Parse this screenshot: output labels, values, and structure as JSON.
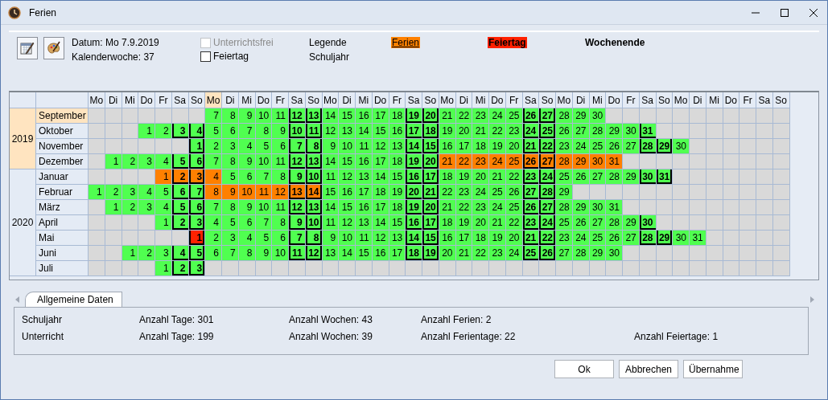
{
  "window": {
    "title": "Ferien"
  },
  "info": {
    "date": "Datum: Mo 7.9.2019",
    "week": "Kalenderwoche: 37"
  },
  "checkboxes": [
    {
      "label": "Unterrichtsfrei",
      "checked": false,
      "disabled": true
    },
    {
      "label": "Feiertag",
      "checked": false,
      "disabled": false
    }
  ],
  "legend": {
    "title": "Legende",
    "subtitle": "Schuljahr",
    "items": [
      {
        "label": "Ferien",
        "kind": "ferien",
        "color": "#ff8000"
      },
      {
        "label": "Feiertag",
        "kind": "feiertag",
        "color": "#ff2000"
      },
      {
        "label": "Wochenende",
        "kind": "weekend"
      }
    ]
  },
  "calendar": {
    "columns": [
      {
        "label": "Mo",
        "selected": false
      },
      {
        "label": "Di",
        "selected": false
      },
      {
        "label": "Mi",
        "selected": false
      },
      {
        "label": "Do",
        "selected": false
      },
      {
        "label": "Fr",
        "selected": false
      },
      {
        "label": "Sa",
        "selected": false
      },
      {
        "label": "So",
        "selected": false
      },
      {
        "label": "Mo",
        "selected": true
      },
      {
        "label": "Di",
        "selected": false
      },
      {
        "label": "Mi",
        "selected": false
      },
      {
        "label": "Do",
        "selected": false
      },
      {
        "label": "Fr",
        "selected": false
      },
      {
        "label": "Sa",
        "selected": false
      },
      {
        "label": "So",
        "selected": false
      },
      {
        "label": "Mo",
        "selected": false
      },
      {
        "label": "Di",
        "selected": false
      },
      {
        "label": "Mi",
        "selected": false
      },
      {
        "label": "Do",
        "selected": false
      },
      {
        "label": "Fr",
        "selected": false
      },
      {
        "label": "Sa",
        "selected": false
      },
      {
        "label": "So",
        "selected": false
      },
      {
        "label": "Mo",
        "selected": false
      },
      {
        "label": "Di",
        "selected": false
      },
      {
        "label": "Mi",
        "selected": false
      },
      {
        "label": "Do",
        "selected": false
      },
      {
        "label": "Fr",
        "selected": false
      },
      {
        "label": "Sa",
        "selected": false
      },
      {
        "label": "So",
        "selected": false
      },
      {
        "label": "Mo",
        "selected": false
      },
      {
        "label": "Di",
        "selected": false
      },
      {
        "label": "Mi",
        "selected": false
      },
      {
        "label": "Do",
        "selected": false
      },
      {
        "label": "Fr",
        "selected": false
      },
      {
        "label": "Sa",
        "selected": false
      },
      {
        "label": "So",
        "selected": false
      },
      {
        "label": "Mo",
        "selected": false
      },
      {
        "label": "Di",
        "selected": false
      },
      {
        "label": "Mi",
        "selected": false
      },
      {
        "label": "Do",
        "selected": false
      },
      {
        "label": "Fr",
        "selected": false
      },
      {
        "label": "Sa",
        "selected": false
      },
      {
        "label": "So",
        "selected": false
      }
    ],
    "years": [
      {
        "year": "2019",
        "selected": true,
        "months": [
          {
            "name": "September",
            "selected": true,
            "cells": [
              {
                "kind": "blank"
              },
              {
                "kind": "blank"
              },
              {
                "kind": "blank"
              },
              {
                "kind": "blank"
              },
              {
                "kind": "blank"
              },
              {
                "kind": "blank"
              },
              {
                "kind": "blank"
              },
              {
                "day": "7",
                "kind": "school"
              },
              {
                "day": "8",
                "kind": "school"
              },
              {
                "day": "9",
                "kind": "school"
              },
              {
                "day": "10",
                "kind": "school"
              },
              {
                "day": "11",
                "kind": "school"
              },
              {
                "day": "12",
                "kind": "school"
              },
              {
                "day": "13",
                "kind": "school"
              },
              {
                "day": "14",
                "kind": "school"
              },
              {
                "day": "15",
                "kind": "school"
              },
              {
                "day": "16",
                "kind": "school"
              },
              {
                "day": "17",
                "kind": "school"
              },
              {
                "day": "18",
                "kind": "school"
              },
              {
                "day": "19",
                "kind": "school"
              },
              {
                "day": "20",
                "kind": "school"
              },
              {
                "day": "21",
                "kind": "school"
              },
              {
                "day": "22",
                "kind": "school"
              },
              {
                "day": "23",
                "kind": "school"
              },
              {
                "day": "24",
                "kind": "school"
              },
              {
                "day": "25",
                "kind": "school"
              },
              {
                "day": "26",
                "kind": "school"
              },
              {
                "day": "27",
                "kind": "school"
              },
              {
                "day": "28",
                "kind": "school"
              },
              {
                "day": "29",
                "kind": "school"
              },
              {
                "day": "30",
                "kind": "school"
              }
            ]
          },
          {
            "name": "Oktober",
            "selected": false,
            "cells": [
              {
                "kind": "blank"
              },
              {
                "kind": "blank"
              },
              {
                "kind": "blank"
              },
              {
                "day": "1",
                "kind": "school"
              },
              {
                "day": "2",
                "kind": "school"
              },
              {
                "day": "3",
                "kind": "school"
              },
              {
                "day": "4",
                "kind": "school"
              },
              {
                "day": "5",
                "kind": "school"
              },
              {
                "day": "6",
                "kind": "school"
              },
              {
                "day": "7",
                "kind": "school"
              },
              {
                "day": "8",
                "kind": "school"
              },
              {
                "day": "9",
                "kind": "school"
              },
              {
                "day": "10",
                "kind": "school"
              },
              {
                "day": "11",
                "kind": "school"
              },
              {
                "day": "12",
                "kind": "school"
              },
              {
                "day": "13",
                "kind": "school"
              },
              {
                "day": "14",
                "kind": "school"
              },
              {
                "day": "15",
                "kind": "school"
              },
              {
                "day": "16",
                "kind": "school"
              },
              {
                "day": "17",
                "kind": "school"
              },
              {
                "day": "18",
                "kind": "school"
              },
              {
                "day": "19",
                "kind": "school"
              },
              {
                "day": "20",
                "kind": "school"
              },
              {
                "day": "21",
                "kind": "school"
              },
              {
                "day": "22",
                "kind": "school"
              },
              {
                "day": "23",
                "kind": "school"
              },
              {
                "day": "24",
                "kind": "school"
              },
              {
                "day": "25",
                "kind": "school"
              },
              {
                "day": "26",
                "kind": "school"
              },
              {
                "day": "27",
                "kind": "school"
              },
              {
                "day": "28",
                "kind": "school"
              },
              {
                "day": "29",
                "kind": "school"
              },
              {
                "day": "30",
                "kind": "school"
              },
              {
                "day": "31",
                "kind": "school"
              }
            ]
          },
          {
            "name": "November",
            "selected": false,
            "cells": [
              {
                "kind": "blank"
              },
              {
                "kind": "blank"
              },
              {
                "kind": "blank"
              },
              {
                "kind": "blank"
              },
              {
                "kind": "blank"
              },
              {
                "kind": "blank"
              },
              {
                "day": "1",
                "kind": "school"
              },
              {
                "day": "2",
                "kind": "school"
              },
              {
                "day": "3",
                "kind": "school"
              },
              {
                "day": "4",
                "kind": "school"
              },
              {
                "day": "5",
                "kind": "school"
              },
              {
                "day": "6",
                "kind": "school"
              },
              {
                "day": "7",
                "kind": "school"
              },
              {
                "day": "8",
                "kind": "school"
              },
              {
                "day": "9",
                "kind": "school"
              },
              {
                "day": "10",
                "kind": "school"
              },
              {
                "day": "11",
                "kind": "school"
              },
              {
                "day": "12",
                "kind": "school"
              },
              {
                "day": "13",
                "kind": "school"
              },
              {
                "day": "14",
                "kind": "school"
              },
              {
                "day": "15",
                "kind": "school"
              },
              {
                "day": "16",
                "kind": "school"
              },
              {
                "day": "17",
                "kind": "school"
              },
              {
                "day": "18",
                "kind": "school"
              },
              {
                "day": "19",
                "kind": "school"
              },
              {
                "day": "20",
                "kind": "school"
              },
              {
                "day": "21",
                "kind": "school"
              },
              {
                "day": "22",
                "kind": "school"
              },
              {
                "day": "23",
                "kind": "school"
              },
              {
                "day": "24",
                "kind": "school"
              },
              {
                "day": "25",
                "kind": "school"
              },
              {
                "day": "26",
                "kind": "school"
              },
              {
                "day": "27",
                "kind": "school"
              },
              {
                "day": "28",
                "kind": "school"
              },
              {
                "day": "29",
                "kind": "school"
              },
              {
                "day": "30",
                "kind": "school"
              }
            ]
          },
          {
            "name": "Dezember",
            "selected": false,
            "cells": [
              {
                "kind": "blank"
              },
              {
                "day": "1",
                "kind": "school"
              },
              {
                "day": "2",
                "kind": "school"
              },
              {
                "day": "3",
                "kind": "school"
              },
              {
                "day": "4",
                "kind": "school"
              },
              {
                "day": "5",
                "kind": "school"
              },
              {
                "day": "6",
                "kind": "school"
              },
              {
                "day": "7",
                "kind": "school"
              },
              {
                "day": "8",
                "kind": "school"
              },
              {
                "day": "9",
                "kind": "school"
              },
              {
                "day": "10",
                "kind": "school"
              },
              {
                "day": "11",
                "kind": "school"
              },
              {
                "day": "12",
                "kind": "school"
              },
              {
                "day": "13",
                "kind": "school"
              },
              {
                "day": "14",
                "kind": "school"
              },
              {
                "day": "15",
                "kind": "school"
              },
              {
                "day": "16",
                "kind": "school"
              },
              {
                "day": "17",
                "kind": "school"
              },
              {
                "day": "18",
                "kind": "school"
              },
              {
                "day": "19",
                "kind": "school"
              },
              {
                "day": "20",
                "kind": "school"
              },
              {
                "day": "21",
                "kind": "ferien"
              },
              {
                "day": "22",
                "kind": "ferien"
              },
              {
                "day": "23",
                "kind": "ferien"
              },
              {
                "day": "24",
                "kind": "ferien"
              },
              {
                "day": "25",
                "kind": "ferien"
              },
              {
                "day": "26",
                "kind": "ferien"
              },
              {
                "day": "27",
                "kind": "ferien"
              },
              {
                "day": "28",
                "kind": "ferien"
              },
              {
                "day": "29",
                "kind": "ferien"
              },
              {
                "day": "30",
                "kind": "ferien"
              },
              {
                "day": "31",
                "kind": "ferien"
              }
            ]
          }
        ]
      },
      {
        "year": "2020",
        "selected": false,
        "months": [
          {
            "name": "Januar",
            "selected": false,
            "cells": [
              {
                "kind": "blank"
              },
              {
                "kind": "blank"
              },
              {
                "kind": "blank"
              },
              {
                "kind": "blank"
              },
              {
                "day": "1",
                "kind": "ferien"
              },
              {
                "day": "2",
                "kind": "ferien"
              },
              {
                "day": "3",
                "kind": "ferien"
              },
              {
                "day": "4",
                "kind": "ferien"
              },
              {
                "day": "5",
                "kind": "school"
              },
              {
                "day": "6",
                "kind": "school"
              },
              {
                "day": "7",
                "kind": "school"
              },
              {
                "day": "8",
                "kind": "school"
              },
              {
                "day": "9",
                "kind": "school"
              },
              {
                "day": "10",
                "kind": "school"
              },
              {
                "day": "11",
                "kind": "school"
              },
              {
                "day": "12",
                "kind": "school"
              },
              {
                "day": "13",
                "kind": "school"
              },
              {
                "day": "14",
                "kind": "school"
              },
              {
                "day": "15",
                "kind": "school"
              },
              {
                "day": "16",
                "kind": "school"
              },
              {
                "day": "17",
                "kind": "school"
              },
              {
                "day": "18",
                "kind": "school"
              },
              {
                "day": "19",
                "kind": "school"
              },
              {
                "day": "20",
                "kind": "school"
              },
              {
                "day": "21",
                "kind": "school"
              },
              {
                "day": "22",
                "kind": "school"
              },
              {
                "day": "23",
                "kind": "school"
              },
              {
                "day": "24",
                "kind": "school"
              },
              {
                "day": "25",
                "kind": "school"
              },
              {
                "day": "26",
                "kind": "school"
              },
              {
                "day": "27",
                "kind": "school"
              },
              {
                "day": "28",
                "kind": "school"
              },
              {
                "day": "29",
                "kind": "school"
              },
              {
                "day": "30",
                "kind": "school"
              },
              {
                "day": "31",
                "kind": "school"
              }
            ]
          },
          {
            "name": "Februar",
            "selected": false,
            "cells": [
              {
                "day": "1",
                "kind": "school"
              },
              {
                "day": "2",
                "kind": "school"
              },
              {
                "day": "3",
                "kind": "school"
              },
              {
                "day": "4",
                "kind": "school"
              },
              {
                "day": "5",
                "kind": "school"
              },
              {
                "day": "6",
                "kind": "school"
              },
              {
                "day": "7",
                "kind": "school"
              },
              {
                "day": "8",
                "kind": "ferien"
              },
              {
                "day": "9",
                "kind": "ferien"
              },
              {
                "day": "10",
                "kind": "ferien"
              },
              {
                "day": "11",
                "kind": "ferien"
              },
              {
                "day": "12",
                "kind": "ferien"
              },
              {
                "day": "13",
                "kind": "ferien"
              },
              {
                "day": "14",
                "kind": "ferien"
              },
              {
                "day": "15",
                "kind": "school"
              },
              {
                "day": "16",
                "kind": "school"
              },
              {
                "day": "17",
                "kind": "school"
              },
              {
                "day": "18",
                "kind": "school"
              },
              {
                "day": "19",
                "kind": "school"
              },
              {
                "day": "20",
                "kind": "school"
              },
              {
                "day": "21",
                "kind": "school"
              },
              {
                "day": "22",
                "kind": "school"
              },
              {
                "day": "23",
                "kind": "school"
              },
              {
                "day": "24",
                "kind": "school"
              },
              {
                "day": "25",
                "kind": "school"
              },
              {
                "day": "26",
                "kind": "school"
              },
              {
                "day": "27",
                "kind": "school"
              },
              {
                "day": "28",
                "kind": "school"
              },
              {
                "day": "29",
                "kind": "school"
              }
            ]
          },
          {
            "name": "März",
            "selected": false,
            "cells": [
              {
                "kind": "blank"
              },
              {
                "day": "1",
                "kind": "school"
              },
              {
                "day": "2",
                "kind": "school"
              },
              {
                "day": "3",
                "kind": "school"
              },
              {
                "day": "4",
                "kind": "school"
              },
              {
                "day": "5",
                "kind": "school"
              },
              {
                "day": "6",
                "kind": "school"
              },
              {
                "day": "7",
                "kind": "school"
              },
              {
                "day": "8",
                "kind": "school"
              },
              {
                "day": "9",
                "kind": "school"
              },
              {
                "day": "10",
                "kind": "school"
              },
              {
                "day": "11",
                "kind": "school"
              },
              {
                "day": "12",
                "kind": "school"
              },
              {
                "day": "13",
                "kind": "school"
              },
              {
                "day": "14",
                "kind": "school"
              },
              {
                "day": "15",
                "kind": "school"
              },
              {
                "day": "16",
                "kind": "school"
              },
              {
                "day": "17",
                "kind": "school"
              },
              {
                "day": "18",
                "kind": "school"
              },
              {
                "day": "19",
                "kind": "school"
              },
              {
                "day": "20",
                "kind": "school"
              },
              {
                "day": "21",
                "kind": "school"
              },
              {
                "day": "22",
                "kind": "school"
              },
              {
                "day": "23",
                "kind": "school"
              },
              {
                "day": "24",
                "kind": "school"
              },
              {
                "day": "25",
                "kind": "school"
              },
              {
                "day": "26",
                "kind": "school"
              },
              {
                "day": "27",
                "kind": "school"
              },
              {
                "day": "28",
                "kind": "school"
              },
              {
                "day": "29",
                "kind": "school"
              },
              {
                "day": "30",
                "kind": "school"
              },
              {
                "day": "31",
                "kind": "school"
              }
            ]
          },
          {
            "name": "April",
            "selected": false,
            "cells": [
              {
                "kind": "blank"
              },
              {
                "kind": "blank"
              },
              {
                "kind": "blank"
              },
              {
                "kind": "blank"
              },
              {
                "day": "1",
                "kind": "school"
              },
              {
                "day": "2",
                "kind": "school"
              },
              {
                "day": "3",
                "kind": "school"
              },
              {
                "day": "4",
                "kind": "school"
              },
              {
                "day": "5",
                "kind": "school"
              },
              {
                "day": "6",
                "kind": "school"
              },
              {
                "day": "7",
                "kind": "school"
              },
              {
                "day": "8",
                "kind": "school"
              },
              {
                "day": "9",
                "kind": "school"
              },
              {
                "day": "10",
                "kind": "school"
              },
              {
                "day": "11",
                "kind": "school"
              },
              {
                "day": "12",
                "kind": "school"
              },
              {
                "day": "13",
                "kind": "school"
              },
              {
                "day": "14",
                "kind": "school"
              },
              {
                "day": "15",
                "kind": "school"
              },
              {
                "day": "16",
                "kind": "school"
              },
              {
                "day": "17",
                "kind": "school"
              },
              {
                "day": "18",
                "kind": "school"
              },
              {
                "day": "19",
                "kind": "school"
              },
              {
                "day": "20",
                "kind": "school"
              },
              {
                "day": "21",
                "kind": "school"
              },
              {
                "day": "22",
                "kind": "school"
              },
              {
                "day": "23",
                "kind": "school"
              },
              {
                "day": "24",
                "kind": "school"
              },
              {
                "day": "25",
                "kind": "school"
              },
              {
                "day": "26",
                "kind": "school"
              },
              {
                "day": "27",
                "kind": "school"
              },
              {
                "day": "28",
                "kind": "school"
              },
              {
                "day": "29",
                "kind": "school"
              },
              {
                "day": "30",
                "kind": "school"
              }
            ]
          },
          {
            "name": "Mai",
            "selected": false,
            "cells": [
              {
                "kind": "blank"
              },
              {
                "kind": "blank"
              },
              {
                "kind": "blank"
              },
              {
                "kind": "blank"
              },
              {
                "kind": "blank"
              },
              {
                "kind": "blank"
              },
              {
                "day": "1",
                "kind": "feiertag"
              },
              {
                "day": "2",
                "kind": "school"
              },
              {
                "day": "3",
                "kind": "school"
              },
              {
                "day": "4",
                "kind": "school"
              },
              {
                "day": "5",
                "kind": "school"
              },
              {
                "day": "6",
                "kind": "school"
              },
              {
                "day": "7",
                "kind": "school"
              },
              {
                "day": "8",
                "kind": "school"
              },
              {
                "day": "9",
                "kind": "school"
              },
              {
                "day": "10",
                "kind": "school"
              },
              {
                "day": "11",
                "kind": "school"
              },
              {
                "day": "12",
                "kind": "school"
              },
              {
                "day": "13",
                "kind": "school"
              },
              {
                "day": "14",
                "kind": "school"
              },
              {
                "day": "15",
                "kind": "school"
              },
              {
                "day": "16",
                "kind": "school"
              },
              {
                "day": "17",
                "kind": "school"
              },
              {
                "day": "18",
                "kind": "school"
              },
              {
                "day": "19",
                "kind": "school"
              },
              {
                "day": "20",
                "kind": "school"
              },
              {
                "day": "21",
                "kind": "school"
              },
              {
                "day": "22",
                "kind": "school"
              },
              {
                "day": "23",
                "kind": "school"
              },
              {
                "day": "24",
                "kind": "school"
              },
              {
                "day": "25",
                "kind": "school"
              },
              {
                "day": "26",
                "kind": "school"
              },
              {
                "day": "27",
                "kind": "school"
              },
              {
                "day": "28",
                "kind": "school"
              },
              {
                "day": "29",
                "kind": "school"
              },
              {
                "day": "30",
                "kind": "school"
              },
              {
                "day": "31",
                "kind": "school"
              }
            ]
          },
          {
            "name": "Juni",
            "selected": false,
            "cells": [
              {
                "kind": "blank"
              },
              {
                "kind": "blank"
              },
              {
                "day": "1",
                "kind": "school"
              },
              {
                "day": "2",
                "kind": "school"
              },
              {
                "day": "3",
                "kind": "school"
              },
              {
                "day": "4",
                "kind": "school"
              },
              {
                "day": "5",
                "kind": "school"
              },
              {
                "day": "6",
                "kind": "school"
              },
              {
                "day": "7",
                "kind": "school"
              },
              {
                "day": "8",
                "kind": "school"
              },
              {
                "day": "9",
                "kind": "school"
              },
              {
                "day": "10",
                "kind": "school"
              },
              {
                "day": "11",
                "kind": "school"
              },
              {
                "day": "12",
                "kind": "school"
              },
              {
                "day": "13",
                "kind": "school"
              },
              {
                "day": "14",
                "kind": "school"
              },
              {
                "day": "15",
                "kind": "school"
              },
              {
                "day": "16",
                "kind": "school"
              },
              {
                "day": "17",
                "kind": "school"
              },
              {
                "day": "18",
                "kind": "school"
              },
              {
                "day": "19",
                "kind": "school"
              },
              {
                "day": "20",
                "kind": "school"
              },
              {
                "day": "21",
                "kind": "school"
              },
              {
                "day": "22",
                "kind": "school"
              },
              {
                "day": "23",
                "kind": "school"
              },
              {
                "day": "24",
                "kind": "school"
              },
              {
                "day": "25",
                "kind": "school"
              },
              {
                "day": "26",
                "kind": "school"
              },
              {
                "day": "27",
                "kind": "school"
              },
              {
                "day": "28",
                "kind": "school"
              },
              {
                "day": "29",
                "kind": "school"
              },
              {
                "day": "30",
                "kind": "school"
              }
            ]
          },
          {
            "name": "Juli",
            "selected": false,
            "cells": [
              {
                "kind": "blank"
              },
              {
                "kind": "blank"
              },
              {
                "kind": "blank"
              },
              {
                "kind": "blank"
              },
              {
                "day": "1",
                "kind": "school"
              },
              {
                "day": "2",
                "kind": "school"
              },
              {
                "day": "3",
                "kind": "school"
              }
            ]
          }
        ]
      }
    ]
  },
  "tabs": [
    {
      "label": "Allgemeine Daten",
      "selected": true
    }
  ],
  "stats": [
    {
      "label": "Schuljahr",
      "days": "Anzahl Tage: 301",
      "weeks": "Anzahl Wochen: 43",
      "holidays": "Anzahl Ferien: 2"
    },
    {
      "label": "Unterricht",
      "days": "Anzahl Tage: 199",
      "weeks": "Anzahl Wochen: 39",
      "holidays": "Anzahl Ferientage: 22",
      "public_holidays": "Anzahl Feiertage: 1"
    }
  ],
  "buttons": [
    {
      "label": "Ok"
    },
    {
      "label": "Abbrechen"
    },
    {
      "label": "Übernahme"
    }
  ]
}
